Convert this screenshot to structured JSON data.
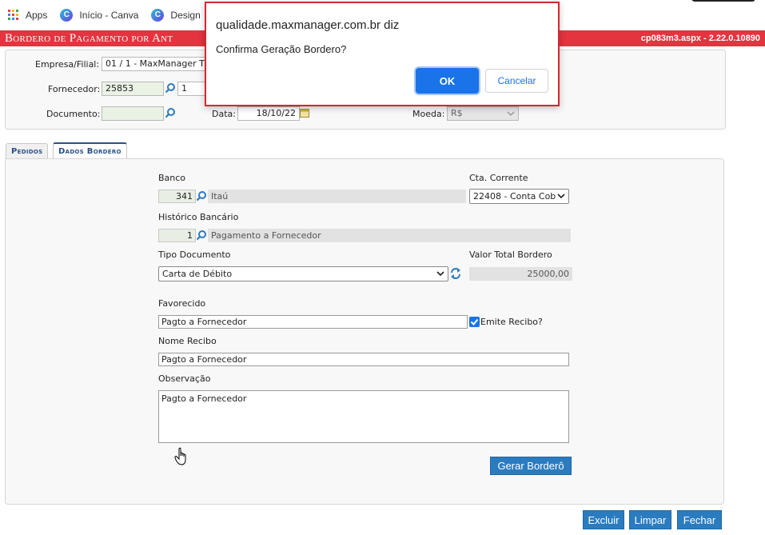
{
  "bookmarks": {
    "items": [
      {
        "label": "Apps",
        "icon": "apps-grid-icon"
      },
      {
        "label": "Início - Canva",
        "icon": "canva-icon"
      },
      {
        "label": "Design",
        "icon": "canva-icon"
      }
    ]
  },
  "page": {
    "title": "Bordero de Pagamento por Ant",
    "version": "cp083m3.aspx - 2.22.0.10890"
  },
  "header": {
    "empresa_label": "Empresa/Filial:",
    "empresa_value": "01 / 1 - MaxManager T",
    "fornecedor_label": "Fornecedor:",
    "fornecedor_code": "25853",
    "fornecedor_seq": "1",
    "documento_label": "Documento:",
    "documento_value": "",
    "data_label": "Data:",
    "data_value": "18/10/22",
    "moeda_label": "Moeda:",
    "moeda_value": "R$"
  },
  "tabs": [
    {
      "label": "Pedidos",
      "active": false
    },
    {
      "label": "Dados Bordero",
      "active": true
    }
  ],
  "form": {
    "banco_label": "Banco",
    "banco_code": "341",
    "banco_name": "Itaú",
    "cta_label": "Cta. Corrente",
    "cta_value": "22408 - Conta Cob",
    "historico_label": "Histórico Bancário",
    "historico_code": "1",
    "historico_name": "Pagamento a Fornecedor",
    "tipo_label": "Tipo Documento",
    "tipo_value": "Carta de Débito",
    "valor_label": "Valor Total Bordero",
    "valor_value": "25000,00",
    "favorecido_label": "Favorecido",
    "favorecido_value": "Pagto a Fornecedor",
    "emite_label": "Emite Recibo?",
    "emite_checked": true,
    "nome_label": "Nome Recibo",
    "nome_value": "Pagto a Fornecedor",
    "obs_label": "Observação",
    "obs_value": "Pagto a Fornecedor",
    "gerar_label": "Gerar Borderô"
  },
  "footer": {
    "excluir": "Excluir",
    "limpar": "Limpar",
    "fechar": "Fechar"
  },
  "dialog": {
    "host": "qualidade.maxmanager.com.br diz",
    "message": "Confirma Geração Bordero?",
    "ok": "OK",
    "cancel": "Cancelar"
  },
  "colors": {
    "title_bar": "#e3343f",
    "button": "#2b7bbf",
    "dialog_ok": "#1a73e8",
    "dialog_border": "#d7262f"
  }
}
